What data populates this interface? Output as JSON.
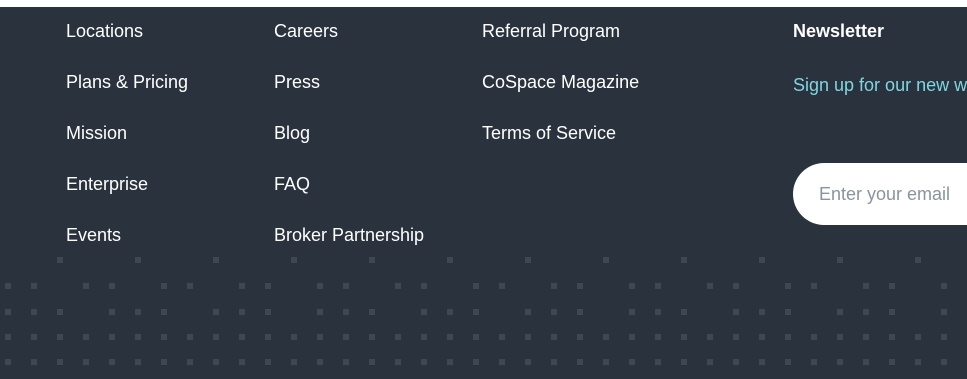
{
  "footer": {
    "links_col1": [
      "Locations",
      "Plans & Pricing",
      "Mission",
      "Enterprise",
      "Events"
    ],
    "links_col2": [
      "Careers",
      "Press",
      "Blog",
      "FAQ",
      "Broker Partnership"
    ],
    "links_col3": [
      "Referral Program",
      "CoSpace Magazine",
      "Terms of Service"
    ]
  },
  "newsletter": {
    "title": "Newsletter",
    "text": "Sign up for our new week.",
    "email_placeholder": "Enter your email"
  },
  "colors": {
    "background": "#29323d",
    "link": "#ffffff",
    "accent": "#7fd6e0",
    "dots": "#3e4752"
  }
}
